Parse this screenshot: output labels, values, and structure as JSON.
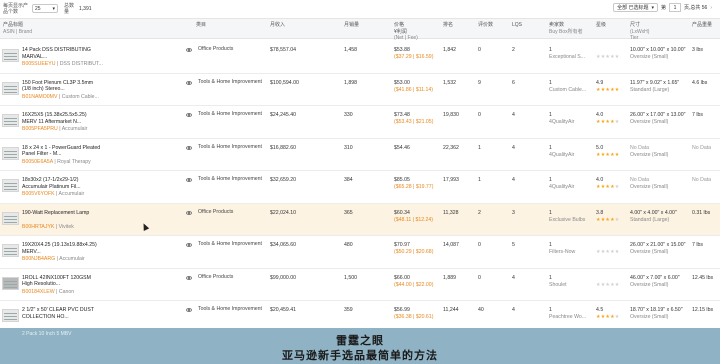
{
  "topbar": {
    "per_page_label": "每页显示产品个数",
    "per_page_value": "25",
    "total_label": "总数量",
    "total_value": "1,391",
    "filter_value": "全部 已选标题",
    "page_prefix": "第",
    "page_value": "1",
    "page_suffix": "页,总共 56"
  },
  "header": {
    "product_title": "产品标题",
    "asin_brand": "ASIN | Brand",
    "category": "类目",
    "revenue": "月收入",
    "sales": "月销量",
    "price": "价格",
    "profit": "¥利润",
    "profit_sub": "(Net | Fee)",
    "rank": "排名",
    "reviews": "评价数",
    "lqs": "LQS",
    "seller_count": "卖家数",
    "buybox": "Buy Box所有者",
    "rating": "星级",
    "size": "尺寸",
    "size_sub": "(LxWxH)",
    "tier": "Tier",
    "weight": "产品重量"
  },
  "rows": [
    {
      "title": "14 Pack DSS DISTRIBUTING MARVAL...",
      "asin": "B005SUEEYU",
      "brand": "DSS DISTRIBUT...",
      "category": "Office Products",
      "revenue": "$78,557.04",
      "sales": "1,458",
      "price": "$53.88",
      "fee": "($37.29 | $16.59)",
      "rank": "1,842",
      "reviews": "0",
      "lqs": "2",
      "sellers": "1",
      "buybox": "Exceptional S...",
      "rating": "",
      "stars": 0,
      "size": "10.00\" x 10.00\" x 10.00\"",
      "tier": "Oversize (Small)",
      "weight": "3 lbs",
      "thumb": "light",
      "highlight": false
    },
    {
      "title": "150 Foot Plenum CL3P 3.5mm (1/8 inch) Stereo...",
      "asin": "B01NAMO0MV",
      "brand": "Custom Cable...",
      "category": "Tools & Home Improvement",
      "revenue": "$100,594.00",
      "sales": "1,898",
      "price": "$53.00",
      "fee": "($41.86 | $11.14)",
      "rank": "1,532",
      "reviews": "9",
      "lqs": "6",
      "sellers": "1",
      "buybox": "Custom Cable...",
      "rating": "4.9",
      "stars": 5,
      "size": "11.97\" x 9.02\" x 1.65\"",
      "tier": "Standard (Large)",
      "weight": "4.6 lbs",
      "thumb": "light",
      "highlight": false
    },
    {
      "title": "16X25X5 (15.38x25.5x5.25) MERV 11 Aftermarket N...",
      "asin": "B005PFA5PRU",
      "brand": "Accumulair",
      "category": "Tools & Home Improvement",
      "revenue": "$24,245.40",
      "sales": "330",
      "price": "$73.48",
      "fee": "($53.43 | $21.05)",
      "rank": "19,830",
      "reviews": "0",
      "lqs": "4",
      "sellers": "1",
      "buybox": "4QualityAir",
      "rating": "4.0",
      "stars": 4,
      "size": "26.00\" x 17.00\" x 13.00\"",
      "tier": "Oversize (Small)",
      "weight": "7 lbs",
      "thumb": "light",
      "highlight": false
    },
    {
      "title": "18 x 24 x 1 - PowerGuard Pleated Panel Filter - M...",
      "asin": "B0050E6A5A",
      "brand": "Royal Therapy",
      "category": "Tools & Home Improvement",
      "revenue": "$16,882.60",
      "sales": "310",
      "price": "$54.46",
      "fee": "",
      "rank": "22,362",
      "reviews": "1",
      "lqs": "4",
      "sellers": "1",
      "buybox": "4QualityAir",
      "rating": "5.0",
      "stars": 5,
      "size": "No Data",
      "tier": "Oversize (Small)",
      "weight": "No Data",
      "thumb": "light",
      "highlight": false
    },
    {
      "title": "18x30x2 (17-1/2x29-1/2) Accumulair Platinum Fil...",
      "asin": "B005V6YOFK",
      "brand": "Accumulair",
      "category": "Tools & Home Improvement",
      "revenue": "$32,659.20",
      "sales": "384",
      "price": "$85.05",
      "fee": "($65.28 | $19.77)",
      "rank": "17,993",
      "reviews": "1",
      "lqs": "4",
      "sellers": "1",
      "buybox": "4QualityAir",
      "rating": "4.0",
      "stars": 4,
      "size": "No Data",
      "tier": "Oversize (Small)",
      "weight": "No Data",
      "thumb": "light",
      "highlight": false
    },
    {
      "title": "190-Watt Replacement Lamp",
      "asin": "B00HRTAJYK",
      "brand": "Vivitek",
      "category": "Office Products",
      "revenue": "$22,024.10",
      "sales": "365",
      "price": "$60.34",
      "fee": "($48.11 | $12.24)",
      "rank": "11,328",
      "reviews": "2",
      "lqs": "3",
      "sellers": "1",
      "buybox": "Exclusive Bulbs",
      "rating": "3.8",
      "stars": 4,
      "size": "4.00\" x 4.00\" x 4.00\"",
      "tier": "Standard (Large)",
      "weight": "0.31 lbs",
      "thumb": "light",
      "highlight": true
    },
    {
      "title": "19X20X4.25 (19.13x19.88x4.25) MERV...",
      "asin": "B00NJB4ARG",
      "brand": "Accumulair",
      "category": "Tools & Home Improvement",
      "revenue": "$34,065.60",
      "sales": "480",
      "price": "$70.97",
      "fee": "($50.29 | $20.68)",
      "rank": "14,087",
      "reviews": "0",
      "lqs": "5",
      "sellers": "1",
      "buybox": "Filters-Now",
      "rating": "",
      "stars": 0,
      "size": "26.00\" x 21.00\" x 15.00\"",
      "tier": "Oversize (Small)",
      "weight": "7 lbs",
      "thumb": "light",
      "highlight": false
    },
    {
      "title": "1ROLL 42INX100FT 120GSM High Resolutio...",
      "asin": "B00184XLEW",
      "brand": "Canon",
      "category": "Office Products",
      "revenue": "$99,000.00",
      "sales": "1,500",
      "price": "$66.00",
      "fee": "($44.00 | $22.00)",
      "rank": "1,889",
      "reviews": "0",
      "lqs": "4",
      "sellers": "1",
      "buybox": "Shoulet",
      "rating": "",
      "stars": 0,
      "size": "46.00\" x 7.00\" x 6.00\"",
      "tier": "Oversize (Small)",
      "weight": "12.45 lbs",
      "thumb": "dark",
      "highlight": false
    },
    {
      "title": "2 1/2\" x 50' CLEAR PVC DUST COLLECTION HO...",
      "asin": "",
      "brand": "",
      "category": "Tools & Home Improvement",
      "revenue": "$20,459.41",
      "sales": "359",
      "price": "$56.99",
      "fee": "($36.38 | $20.61)",
      "rank": "11,244",
      "reviews": "40",
      "lqs": "4",
      "sellers": "1",
      "buybox": "Peachtree Wo...",
      "rating": "4.5",
      "stars": 4,
      "size": "18.70\" x 18.19\" x 6.50\"",
      "tier": "Oversize (Small)",
      "weight": "12.15 lbs",
      "thumb": "light",
      "highlight": false
    }
  ],
  "banner": {
    "line1": "雷霆之眼",
    "line2": "亚马逊新手选品最简单的方法",
    "peek": "2 Pack 10 Inch 5 MBV"
  }
}
